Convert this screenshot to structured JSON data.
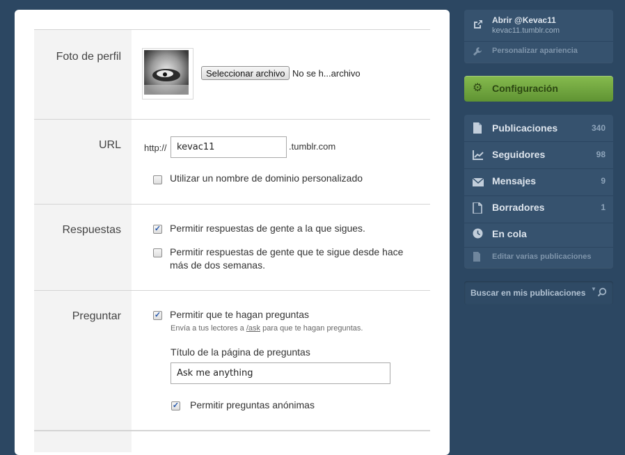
{
  "profile_photo": {
    "label": "Foto de perfil",
    "file_button": "Seleccionar archivo",
    "file_status": "No se h...archivo"
  },
  "url": {
    "label": "URL",
    "prefix": "http://",
    "value": "kevac11",
    "suffix": ".tumblr.com",
    "custom_domain_label": "Utilizar un nombre de dominio personalizado",
    "custom_domain_checked": false
  },
  "replies": {
    "label": "Respuestas",
    "opt1": "Permitir respuestas de gente a la que sigues.",
    "opt1_checked": true,
    "opt2": "Permitir respuestas de gente que te sigue desde hace más de dos semanas.",
    "opt2_checked": false
  },
  "ask": {
    "label": "Preguntar",
    "allow": "Permitir que te hagan preguntas",
    "allow_checked": true,
    "hint_before": "Envía a tus lectores a ",
    "hint_link": "/ask",
    "hint_after": " para que te hagan preguntas.",
    "page_title_label": "Título de la página de preguntas",
    "page_title_value": "Ask me anything",
    "anon": "Permitir preguntas anónimas",
    "anon_checked": true
  },
  "sidebar": {
    "blog_title": "Abrir @Kevac11",
    "blog_url": "kevac11.tumblr.com",
    "customize": "Personalizar apariencia",
    "settings": "Configuración",
    "nav": [
      {
        "label": "Publicaciones",
        "count": "340",
        "icon": "document-icon"
      },
      {
        "label": "Seguidores",
        "count": "98",
        "icon": "chart-icon"
      },
      {
        "label": "Mensajes",
        "count": "9",
        "icon": "envelope-icon"
      },
      {
        "label": "Borradores",
        "count": "1",
        "icon": "draft-icon"
      },
      {
        "label": "En cola",
        "count": "",
        "icon": "clock-icon"
      }
    ],
    "mass_edit": "Editar varias publicaciones",
    "search_placeholder": "Buscar en mis publicaciones"
  },
  "colors": {
    "background": "#2c4762",
    "settings_green": "#6a9e3a",
    "sidebar_box": "#36526e"
  }
}
